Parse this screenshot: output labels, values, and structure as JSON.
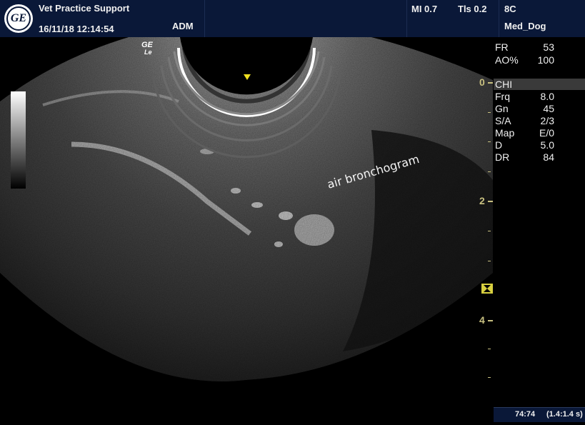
{
  "header": {
    "clinic": "Vet Practice Support",
    "datetime": "16/11/18 12:14:54",
    "operator": "ADM",
    "mi": "MI 0.7",
    "tis": "Tls 0.2",
    "probe": "8C",
    "preset": "Med_Dog",
    "logo_text": "GE"
  },
  "scan": {
    "probe_mark": "GE",
    "probe_mark_sub": "Le",
    "annotation": "air bronchogram",
    "grayscale_bar": "grayscale-bar"
  },
  "params": {
    "fr_label": "FR",
    "fr_value": "53",
    "ao_label": "AO%",
    "ao_value": "100",
    "mode": "CHI",
    "frq_label": "Frq",
    "frq_value": "8.0",
    "gn_label": "Gn",
    "gn_value": "45",
    "sa_label": "S/A",
    "sa_value": "2/3",
    "map_label": "Map",
    "map_value": "E/0",
    "d_label": "D",
    "d_value": "5.0",
    "dr_label": "DR",
    "dr_value": "84"
  },
  "depth_scale": {
    "labels": [
      "0",
      "2",
      "4"
    ]
  },
  "footer": {
    "frames": "74:74",
    "duration": "(1.4:1.4 s)"
  },
  "colors": {
    "header_bg": "#0a1838",
    "depth_marker": "#c8c080",
    "focus_marker": "#d8d040",
    "probe_triangle": "#f0e020"
  }
}
